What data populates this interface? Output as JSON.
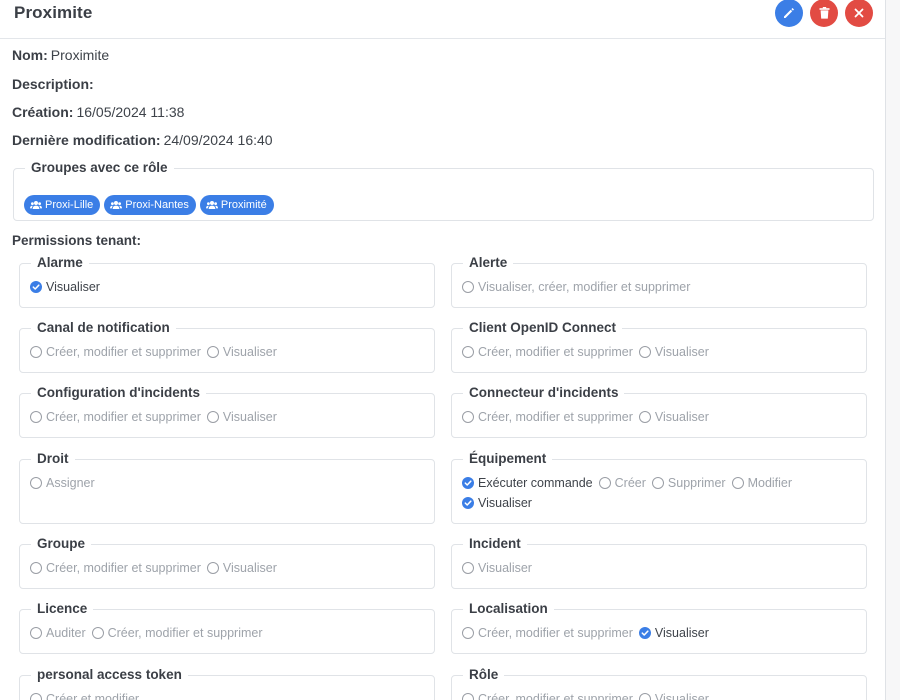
{
  "header": {
    "title": "Proximite",
    "edit_icon": "pencil-icon",
    "delete_icon": "trash-icon",
    "close_icon": "close-icon",
    "colors": {
      "primary": "#3b7ee6",
      "danger": "#e24b43"
    }
  },
  "info": {
    "name_label": "Nom:",
    "name_value": "Proximite",
    "description_label": "Description:",
    "description_value": "",
    "created_label": "Création:",
    "created_value": "16/05/2024 11:38",
    "modified_label": "Dernière modification:",
    "modified_value": "24/09/2024 16:40"
  },
  "groups": {
    "legend": "Groupes avec ce rôle",
    "icon": "users-icon",
    "items": [
      "Proxi-Lille",
      "Proxi-Nantes",
      "Proximité"
    ]
  },
  "permissions_label": "Permissions tenant:",
  "permissions": [
    {
      "title": "Alarme",
      "options": [
        {
          "label": "Visualiser",
          "checked": true
        }
      ]
    },
    {
      "title": "Alerte",
      "options": [
        {
          "label": "Visualiser, créer, modifier et supprimer",
          "checked": false
        }
      ]
    },
    {
      "title": "Canal de notification",
      "options": [
        {
          "label": "Créer, modifier et supprimer",
          "checked": false
        },
        {
          "label": "Visualiser",
          "checked": false
        }
      ]
    },
    {
      "title": "Client OpenID Connect",
      "options": [
        {
          "label": "Créer, modifier et supprimer",
          "checked": false
        },
        {
          "label": "Visualiser",
          "checked": false
        }
      ]
    },
    {
      "title": "Configuration d'incidents",
      "options": [
        {
          "label": "Créer, modifier et supprimer",
          "checked": false
        },
        {
          "label": "Visualiser",
          "checked": false
        }
      ]
    },
    {
      "title": "Connecteur d'incidents",
      "options": [
        {
          "label": "Créer, modifier et supprimer",
          "checked": false
        },
        {
          "label": "Visualiser",
          "checked": false
        }
      ]
    },
    {
      "title": "Droit",
      "options": [
        {
          "label": "Assigner",
          "checked": false
        }
      ]
    },
    {
      "title": "Équipement",
      "options": [
        {
          "label": "Exécuter commande",
          "checked": true
        },
        {
          "label": "Créer",
          "checked": false
        },
        {
          "label": "Supprimer",
          "checked": false
        },
        {
          "label": "Modifier",
          "checked": false
        },
        {
          "label": "Visualiser",
          "checked": true
        }
      ]
    },
    {
      "title": "Groupe",
      "options": [
        {
          "label": "Créer, modifier et supprimer",
          "checked": false
        },
        {
          "label": "Visualiser",
          "checked": false
        }
      ]
    },
    {
      "title": "Incident",
      "options": [
        {
          "label": "Visualiser",
          "checked": false
        }
      ]
    },
    {
      "title": "Licence",
      "options": [
        {
          "label": "Auditer",
          "checked": false
        },
        {
          "label": "Créer, modifier et supprimer",
          "checked": false
        }
      ]
    },
    {
      "title": "Localisation",
      "options": [
        {
          "label": "Créer, modifier et supprimer",
          "checked": false
        },
        {
          "label": "Visualiser",
          "checked": true
        }
      ]
    },
    {
      "title": "personal access token",
      "options": [
        {
          "label": "Créer et modifier",
          "checked": false
        }
      ]
    },
    {
      "title": "Rôle",
      "options": [
        {
          "label": "Créer, modifier et supprimer",
          "checked": false
        },
        {
          "label": "Visualiser",
          "checked": false
        }
      ]
    }
  ]
}
